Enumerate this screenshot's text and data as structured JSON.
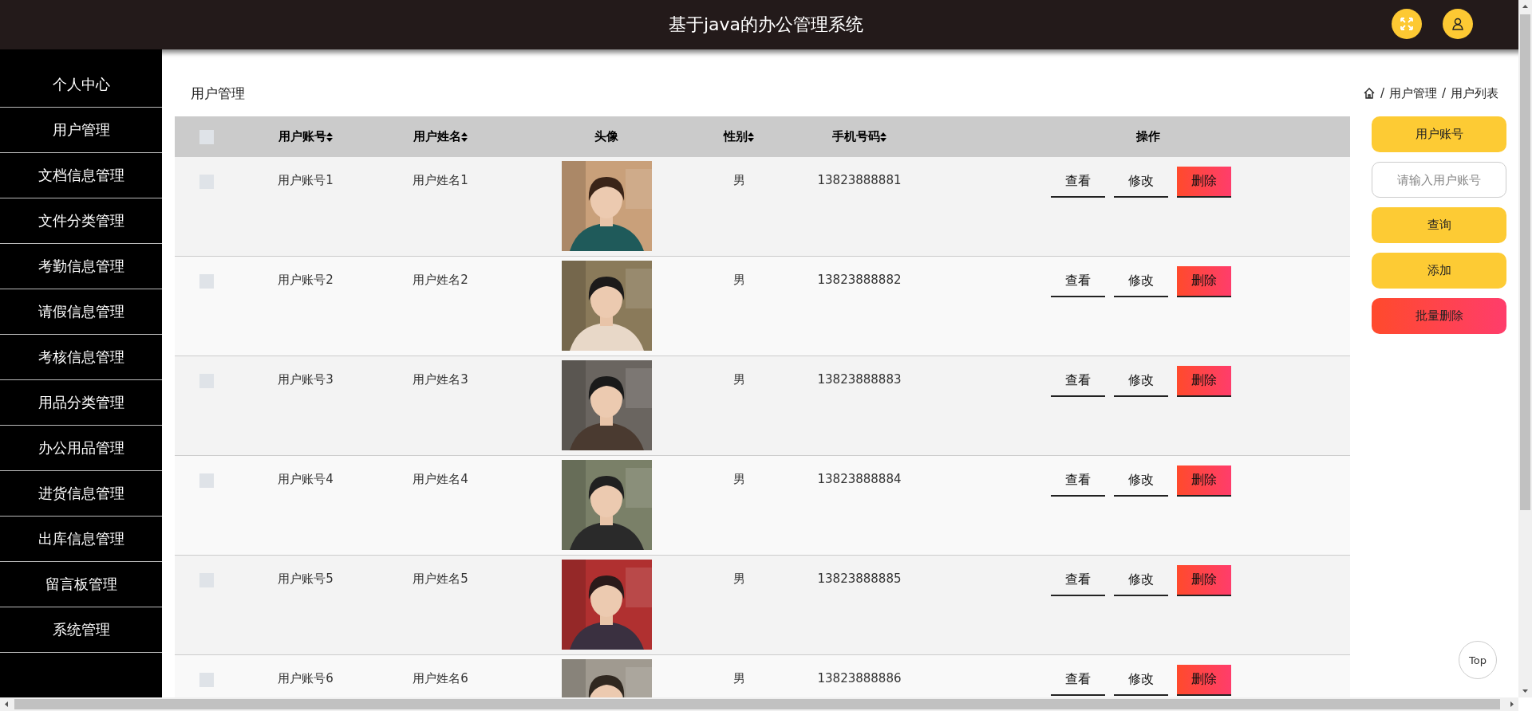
{
  "header": {
    "title": "基于java的办公管理系统"
  },
  "sidebar": {
    "items": [
      {
        "label": "个人中心"
      },
      {
        "label": "用户管理"
      },
      {
        "label": "文档信息管理"
      },
      {
        "label": "文件分类管理"
      },
      {
        "label": "考勤信息管理"
      },
      {
        "label": "请假信息管理"
      },
      {
        "label": "考核信息管理"
      },
      {
        "label": "用品分类管理"
      },
      {
        "label": "办公用品管理"
      },
      {
        "label": "进货信息管理"
      },
      {
        "label": "出库信息管理"
      },
      {
        "label": "留言板管理"
      },
      {
        "label": "系统管理"
      }
    ]
  },
  "page": {
    "title": "用户管理",
    "breadcrumb": {
      "separator": "/",
      "items": [
        "用户管理",
        "用户列表"
      ]
    }
  },
  "table": {
    "columns": [
      {
        "kind": "checkbox",
        "checked": false
      },
      {
        "kind": "text",
        "label": "用户账号",
        "sortable": true
      },
      {
        "kind": "text",
        "label": "用户姓名",
        "sortable": true
      },
      {
        "kind": "text",
        "label": "头像",
        "sortable": false
      },
      {
        "kind": "text",
        "label": "性别",
        "sortable": true
      },
      {
        "kind": "text",
        "label": "手机号码",
        "sortable": true
      },
      {
        "kind": "text",
        "label": "操作",
        "sortable": false
      }
    ],
    "rows": [
      {
        "checked": false,
        "account": "用户账号1",
        "name": "用户姓名1",
        "gender": "男",
        "phone": "13823888881",
        "actions": [
          {
            "kind": "plain",
            "label": "查看"
          },
          {
            "kind": "plain",
            "label": "修改"
          },
          {
            "kind": "danger",
            "label": "删除"
          }
        ]
      },
      {
        "checked": false,
        "account": "用户账号2",
        "name": "用户姓名2",
        "gender": "男",
        "phone": "13823888882",
        "actions": [
          {
            "kind": "plain",
            "label": "查看"
          },
          {
            "kind": "plain",
            "label": "修改"
          },
          {
            "kind": "danger",
            "label": "删除"
          }
        ]
      },
      {
        "checked": false,
        "account": "用户账号3",
        "name": "用户姓名3",
        "gender": "男",
        "phone": "13823888883",
        "actions": [
          {
            "kind": "plain",
            "label": "查看"
          },
          {
            "kind": "plain",
            "label": "修改"
          },
          {
            "kind": "danger",
            "label": "删除"
          }
        ]
      },
      {
        "checked": false,
        "account": "用户账号4",
        "name": "用户姓名4",
        "gender": "男",
        "phone": "13823888884",
        "actions": [
          {
            "kind": "plain",
            "label": "查看"
          },
          {
            "kind": "plain",
            "label": "修改"
          },
          {
            "kind": "danger",
            "label": "删除"
          }
        ]
      },
      {
        "checked": false,
        "account": "用户账号5",
        "name": "用户姓名5",
        "gender": "男",
        "phone": "13823888885",
        "actions": [
          {
            "kind": "plain",
            "label": "查看"
          },
          {
            "kind": "plain",
            "label": "修改"
          },
          {
            "kind": "danger",
            "label": "删除"
          }
        ]
      },
      {
        "checked": false,
        "account": "用户账号6",
        "name": "用户姓名6",
        "gender": "男",
        "phone": "13823888886",
        "actions": [
          {
            "kind": "plain",
            "label": "查看"
          },
          {
            "kind": "plain",
            "label": "修改"
          },
          {
            "kind": "danger",
            "label": "删除"
          }
        ]
      }
    ]
  },
  "search": {
    "label": "用户账号",
    "placeholder": "请输入用户账号",
    "buttons": [
      {
        "kind": "primary",
        "label": "查询"
      },
      {
        "kind": "primary",
        "label": "添加"
      },
      {
        "kind": "danger",
        "label": "批量删除"
      }
    ]
  },
  "back_to_top": {
    "label": "Top"
  }
}
